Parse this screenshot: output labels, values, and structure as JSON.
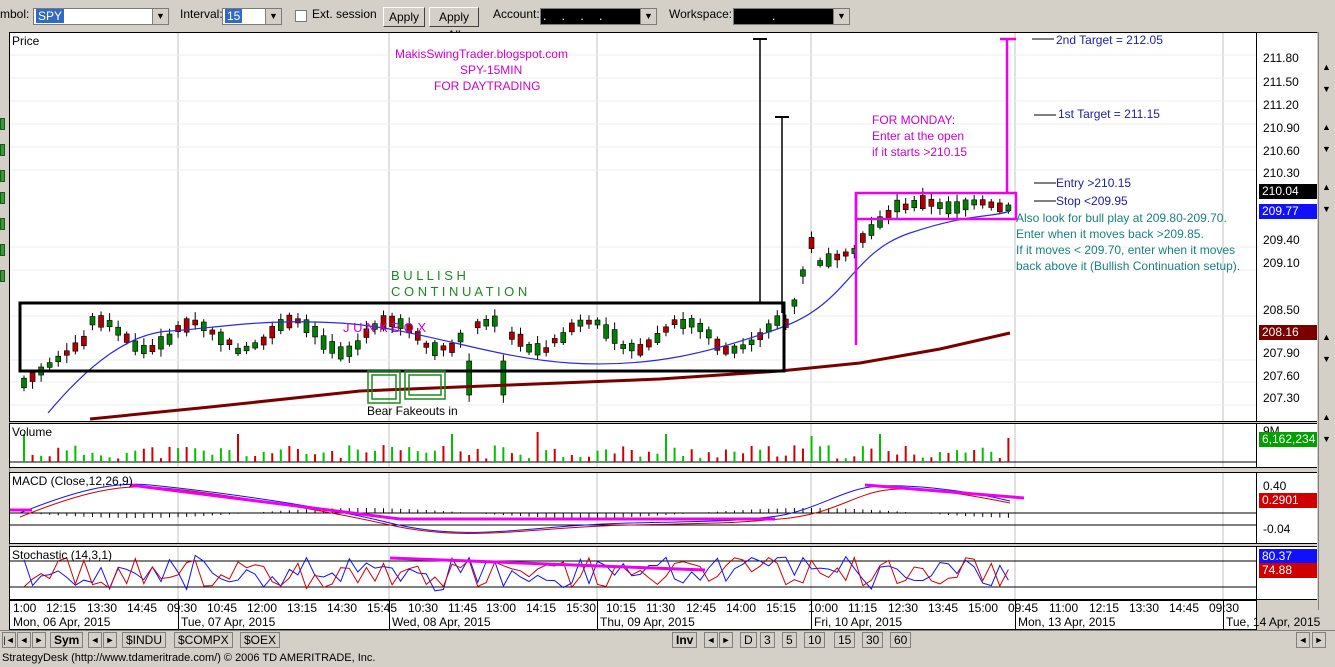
{
  "toolbar": {
    "symbol_label": "mbol:",
    "symbol_value": "SPY",
    "interval_label": "Interval:",
    "interval_value": "15",
    "ext_session_label": "Ext. session",
    "apply_label": "Apply",
    "apply_all_label": "Apply All",
    "account_label": "Account:",
    "account_value": ".  .  .  .",
    "workspace_label": "Workspace:",
    "workspace_value": "."
  },
  "price_pane": {
    "title": "Price",
    "ticks": [
      "211.80",
      "211.50",
      "211.20",
      "210.90",
      "210.60",
      "210.30",
      "210.04",
      "209.77",
      "209.40",
      "209.10",
      "208.50",
      "208.16",
      "207.90",
      "207.60",
      "207.30"
    ],
    "last_price_tag": "210.04",
    "ma_tag": "209.77",
    "ma2_tag": "208.16",
    "colors": {
      "candle_up": "#008000",
      "candle_down": "#b00000",
      "ma_fast": "#2a2ae0",
      "ma_slow": "#7a0000",
      "annotation": "#cc00cc",
      "box": "#000000"
    }
  },
  "annotations": {
    "header_line1": "MakisSwingTrader.blogspot.com",
    "header_line2": "SPY-15MIN",
    "header_line3": "FOR DAYTRADING",
    "bullish_word": "B  U  L  L  I  S  H",
    "continuation_word": "C  O  N  T  I  N  U  A  T  I  O  N",
    "junk_box_word": "J  U  N  K  B  O  X",
    "bear_fakeouts": "Bear Fakeouts in",
    "for_monday_1": "FOR MONDAY:",
    "for_monday_2": "Enter at the open",
    "for_monday_3": "if it starts >210.15",
    "second_target": "2nd Target = 212.05",
    "first_target": "1st Target = 211.15",
    "entry": "Entry >210.15",
    "stop": "Stop <209.95",
    "also_1": "Also look for bull play at 209.80-209.70.",
    "also_2": "Enter when it moves back >209.85.",
    "also_3": "If it moves < 209.70, enter when it moves",
    "also_4": "back above it (Bullish Continuation setup)."
  },
  "volume_pane": {
    "title": "Volume",
    "tick_top": "9M",
    "tag": "6,162,234"
  },
  "macd_pane": {
    "title": "MACD (Close,12,26,9)",
    "tick_top": "0.40",
    "tag": "0.2901",
    "tick_bottom": "-0.04"
  },
  "stoch_pane": {
    "title": "Stochastic (14,3,1)",
    "tag_top": "80.37",
    "tag_bottom": "74.88"
  },
  "time_axis": {
    "times": [
      "1:00",
      "12:15",
      "13:30",
      "14:45",
      "09:30",
      "10:45",
      "12:00",
      "13:15",
      "14:30",
      "15:45",
      "10:30",
      "11:45",
      "13:00",
      "14:15",
      "15:30",
      "10:15",
      "11:30",
      "12:45",
      "14:00",
      "15:15",
      "10:00",
      "11:15",
      "12:30",
      "13:45",
      "15:00",
      "09:45",
      "11:00",
      "12:15",
      "13:30",
      "14:45",
      "09:30"
    ],
    "dates": [
      "Mon, 06 Apr, 2015",
      "Tue, 07 Apr, 2015",
      "Wed, 08 Apr, 2015",
      "Thu, 09 Apr, 2015",
      "Fri, 10 Apr, 2015",
      "Mon, 13 Apr, 2015",
      "Tue, 14 Apr, 2015"
    ]
  },
  "tabs": {
    "sym": "Sym",
    "symbols": [
      "$INDU",
      "$COMPX",
      "$OEX"
    ],
    "inv": "Inv",
    "periods": [
      "D",
      "3",
      "5",
      "10",
      "15",
      "30",
      "60"
    ]
  },
  "status": "StrategyDesk (http://www.tdameritrade.com/) © 2006 TD AMERITRADE, Inc."
}
